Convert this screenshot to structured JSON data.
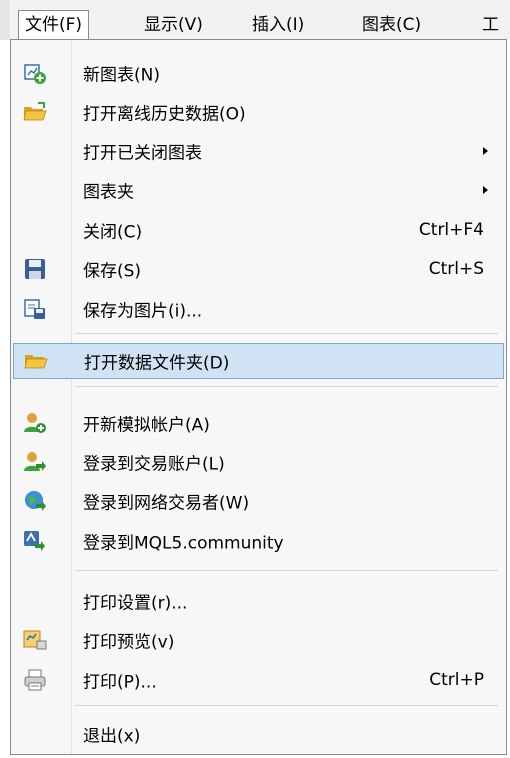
{
  "menubar": {
    "items": [
      "文件(F)",
      "显示(V)",
      "插入(I)",
      "图表(C)",
      "工"
    ]
  },
  "dropdown": {
    "items": [
      {
        "label": "新图表(N)",
        "shortcut": "",
        "icon": "new-chart-icon"
      },
      {
        "label": "打开离线历史数据(O)",
        "shortcut": "",
        "icon": "open-folder-icon"
      },
      {
        "label": "打开已关闭图表",
        "shortcut": "",
        "icon": "",
        "submenu": true
      },
      {
        "label": "图表夹",
        "shortcut": "",
        "icon": "",
        "submenu": true
      },
      {
        "label": "关闭(C)",
        "shortcut": "Ctrl+F4",
        "icon": ""
      },
      {
        "label": "保存(S)",
        "shortcut": "Ctrl+S",
        "icon": "save-icon"
      },
      {
        "label": "保存为图片(i)...",
        "shortcut": "",
        "icon": "save-picture-icon"
      },
      {
        "label": "打开数据文件夹(D)",
        "shortcut": "",
        "icon": "folder-icon",
        "highlighted": true
      },
      {
        "label": "开新模拟帐户(A)",
        "shortcut": "",
        "icon": "new-account-icon"
      },
      {
        "label": "登录到交易账户(L)",
        "shortcut": "",
        "icon": "login-account-icon"
      },
      {
        "label": "登录到网络交易者(W)",
        "shortcut": "",
        "icon": "web-trader-icon"
      },
      {
        "label": "登录到MQL5.community",
        "shortcut": "",
        "icon": "mql5-icon"
      },
      {
        "label": "打印设置(r)...",
        "shortcut": "",
        "icon": ""
      },
      {
        "label": "打印预览(v)",
        "shortcut": "",
        "icon": "print-preview-icon"
      },
      {
        "label": "打印(P)...",
        "shortcut": "Ctrl+P",
        "icon": "printer-icon"
      },
      {
        "label": "退出(x)",
        "shortcut": "",
        "icon": ""
      }
    ]
  },
  "colors": {
    "highlight": "#cfe3f4",
    "highlight_border": "#7ea6cc",
    "menubar_bg": "#f2f2f2",
    "dropdown_bg": "#f7f7f7"
  }
}
